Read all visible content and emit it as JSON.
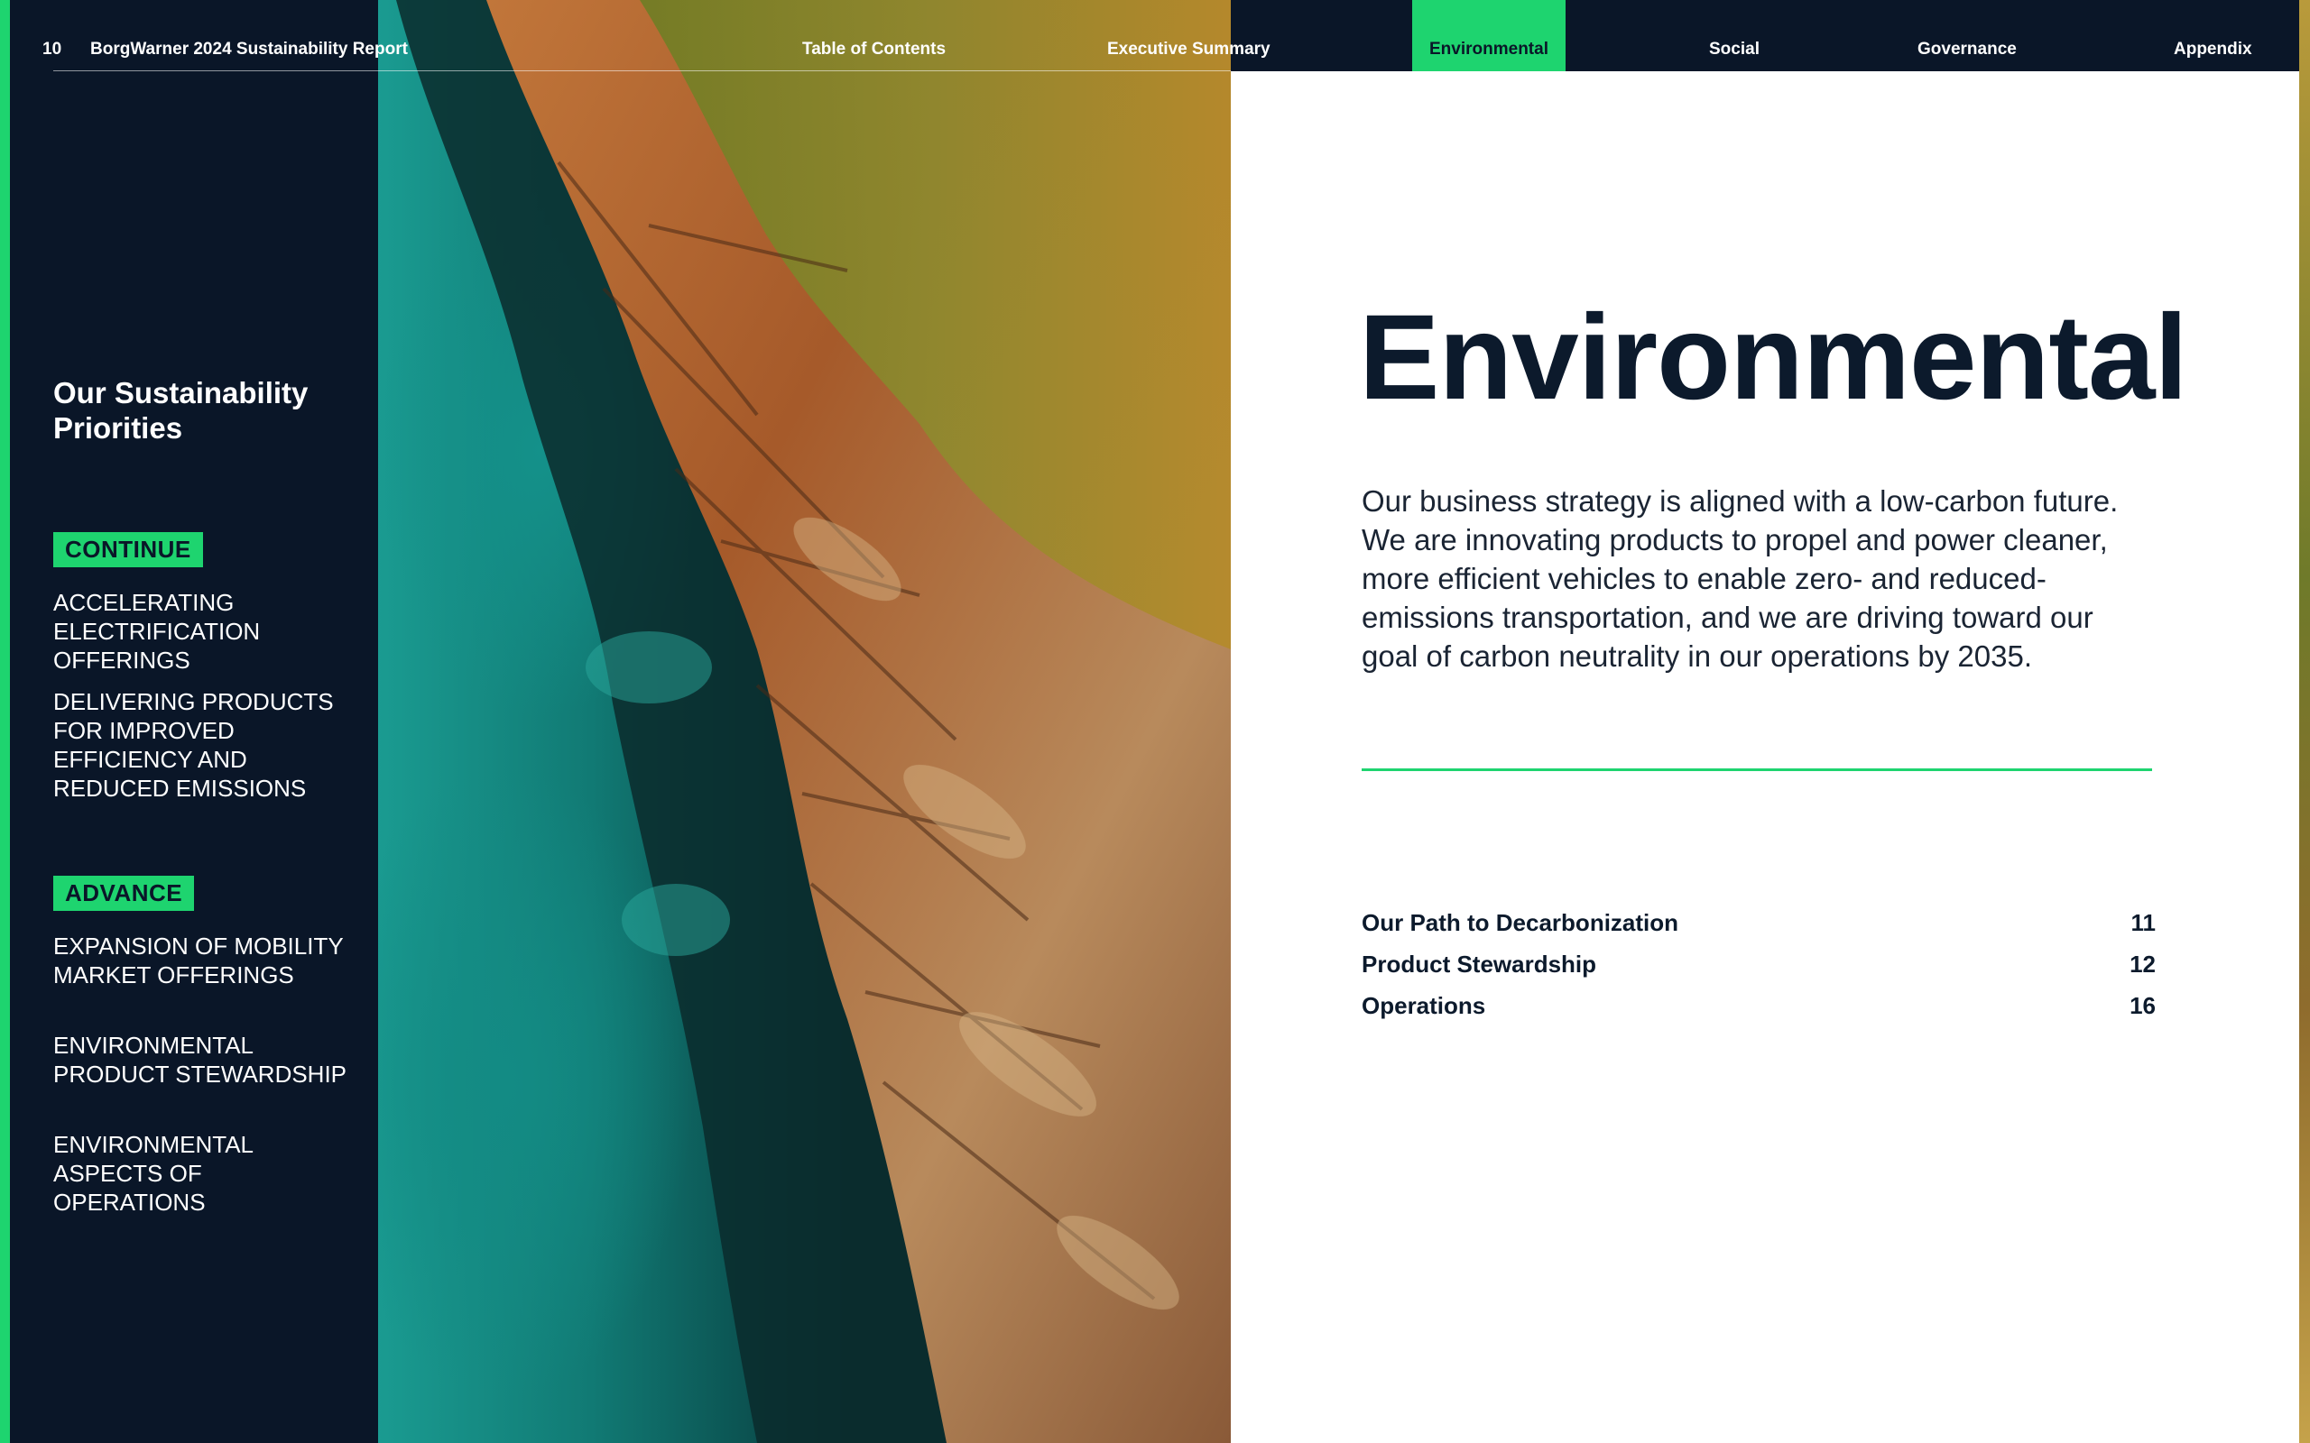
{
  "header": {
    "page_number": "10",
    "report_title": "BorgWarner 2024 Sustainability Report",
    "nav": [
      {
        "label": "Table of Contents",
        "active": false
      },
      {
        "label": "Executive Summary",
        "active": false
      },
      {
        "label": "Environmental",
        "active": true
      },
      {
        "label": "Social",
        "active": false
      },
      {
        "label": "Governance",
        "active": false
      },
      {
        "label": "Appendix",
        "active": false
      }
    ]
  },
  "sidebar": {
    "title": "Our Sustainability Priorities",
    "groups": [
      {
        "badge": "CONTINUE",
        "items": [
          "ACCELERATING ELECTRIFICATION OFFERINGS",
          "DELIVERING PRODUCTS FOR IMPROVED EFFICIENCY AND REDUCED EMISSIONS"
        ]
      },
      {
        "badge": "ADVANCE",
        "items": [
          "EXPANSION OF MOBILITY MARKET OFFERINGS",
          "ENVIRONMENTAL PRODUCT STEWARDSHIP",
          "ENVIRONMENTAL ASPECTS OF OPERATIONS"
        ]
      }
    ]
  },
  "main": {
    "title": "Environmental",
    "body": "Our business strategy is aligned with a low-carbon future. We are innovating products to propel and power cleaner, more efficient vehicles to enable zero- and reduced-emissions transportation, and we are driving toward our goal of carbon neutrality in our operations by 2035.",
    "toc": [
      {
        "label": "Our Path to Decarbonization",
        "page": "11"
      },
      {
        "label": "Product Stewardship",
        "page": "12"
      },
      {
        "label": "Operations",
        "page": "16"
      }
    ]
  },
  "colors": {
    "navy": "#0a1628",
    "accent_green": "#1ed46f",
    "title_text": "#0c1a2c"
  },
  "image": {
    "subject": "aerial-coastline-photo"
  }
}
